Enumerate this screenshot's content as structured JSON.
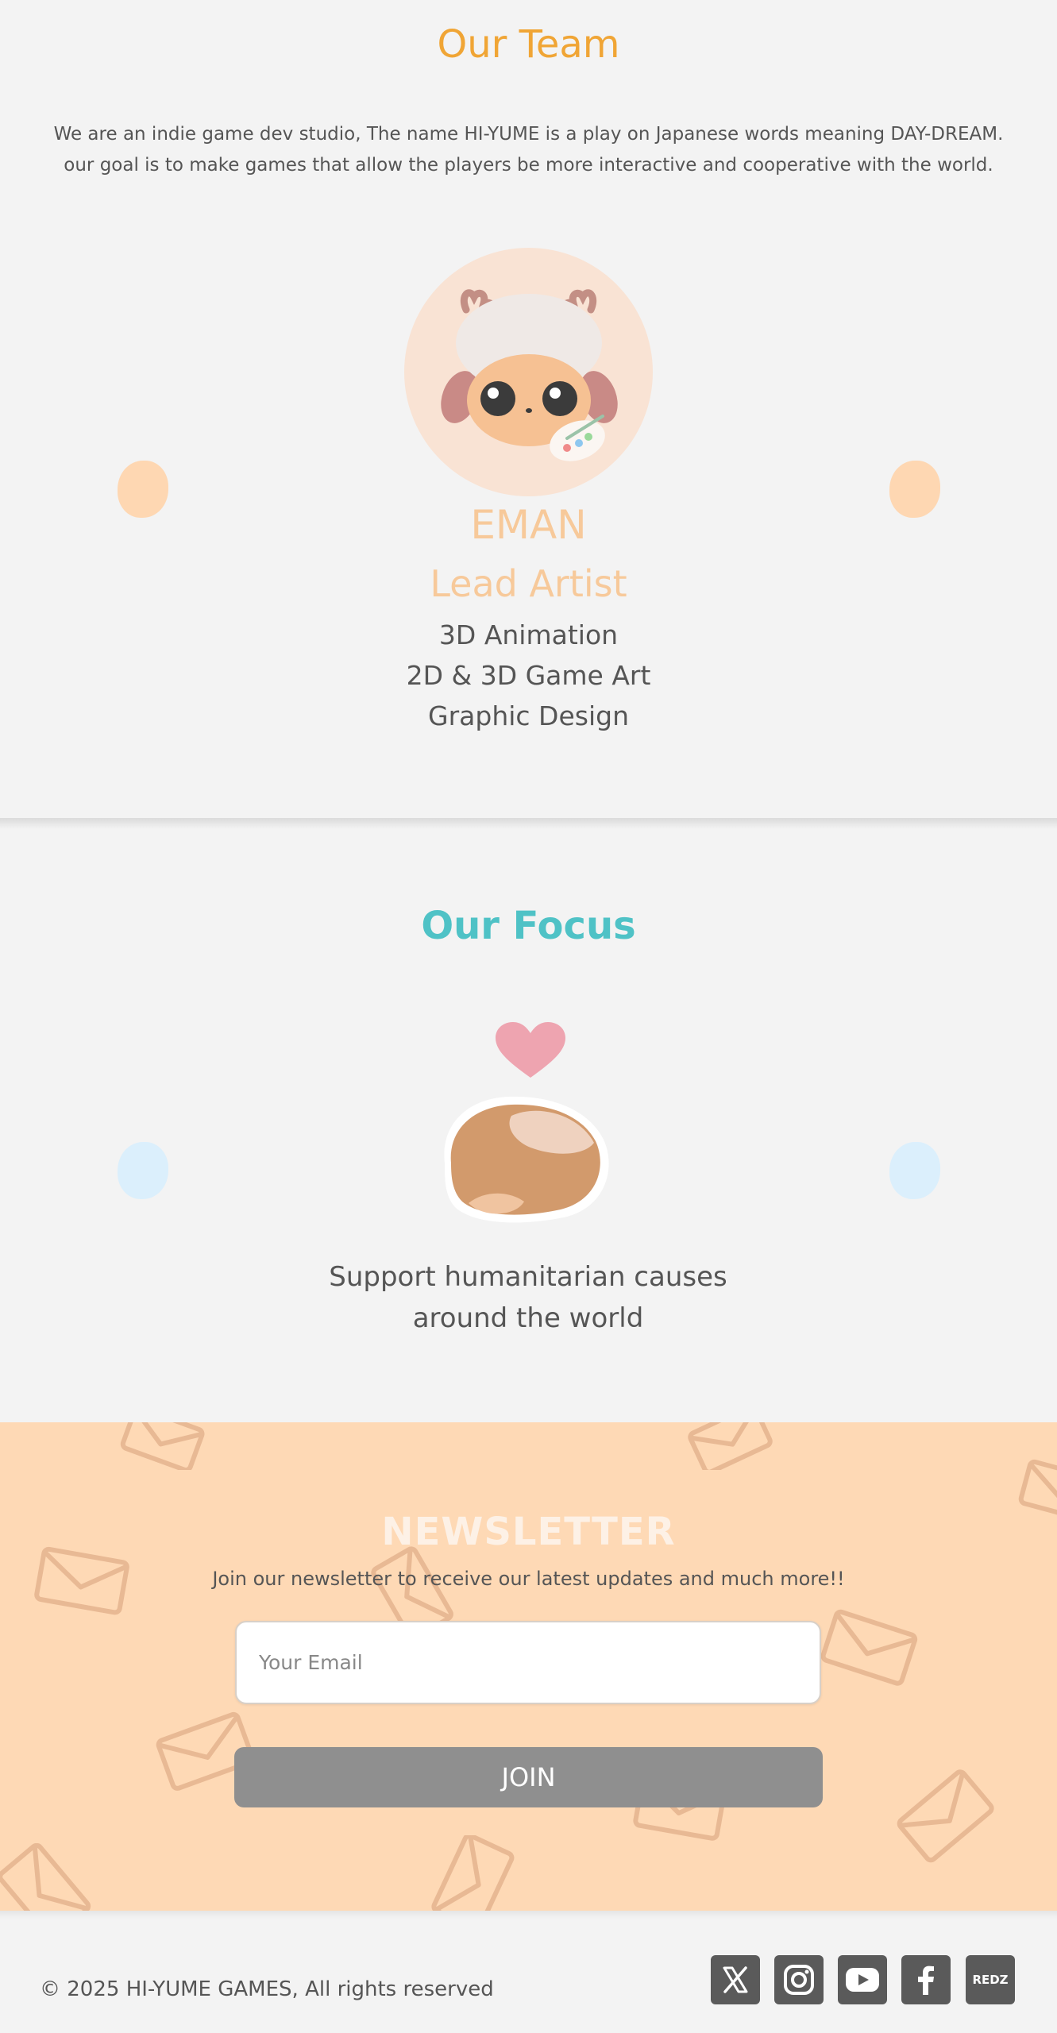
{
  "team": {
    "title": "Our Team",
    "intro_line1": "We are an indie game dev studio, The name HI-YUME is a play on Japanese words meaning DAY-DREAM.",
    "intro_line2": "our goal is to make games that allow the players be more interactive and cooperative with the world.",
    "member": {
      "name": "EMAN",
      "role": "Lead Artist",
      "skills": [
        "3D Animation",
        "2D & 3D Game Art",
        "Graphic Design"
      ]
    }
  },
  "focus": {
    "title": "Our Focus",
    "text": "Support humanitarian causes around the world"
  },
  "newsletter": {
    "title": "NEWSLETTER",
    "subtitle": "Join our newsletter to receive our latest updates and much more!!",
    "email_placeholder": "Your Email",
    "join_label": "JOIN"
  },
  "footer": {
    "copyright": "© 2025 HI-YUME GAMES, All rights reserved",
    "social": [
      {
        "icon": "x-twitter-icon"
      },
      {
        "icon": "instagram-icon"
      },
      {
        "icon": "youtube-icon"
      },
      {
        "icon": "facebook-icon"
      },
      {
        "icon": "redz-icon",
        "label": "REDZ"
      }
    ]
  },
  "colors": {
    "team_title": "#f0a535",
    "member_accent": "#f7c99a",
    "focus_title": "#4fc2c6",
    "newsletter_bg": "#fed9b5",
    "join_button": "#8f8f8f",
    "page_bg": "#f3f3f3"
  }
}
